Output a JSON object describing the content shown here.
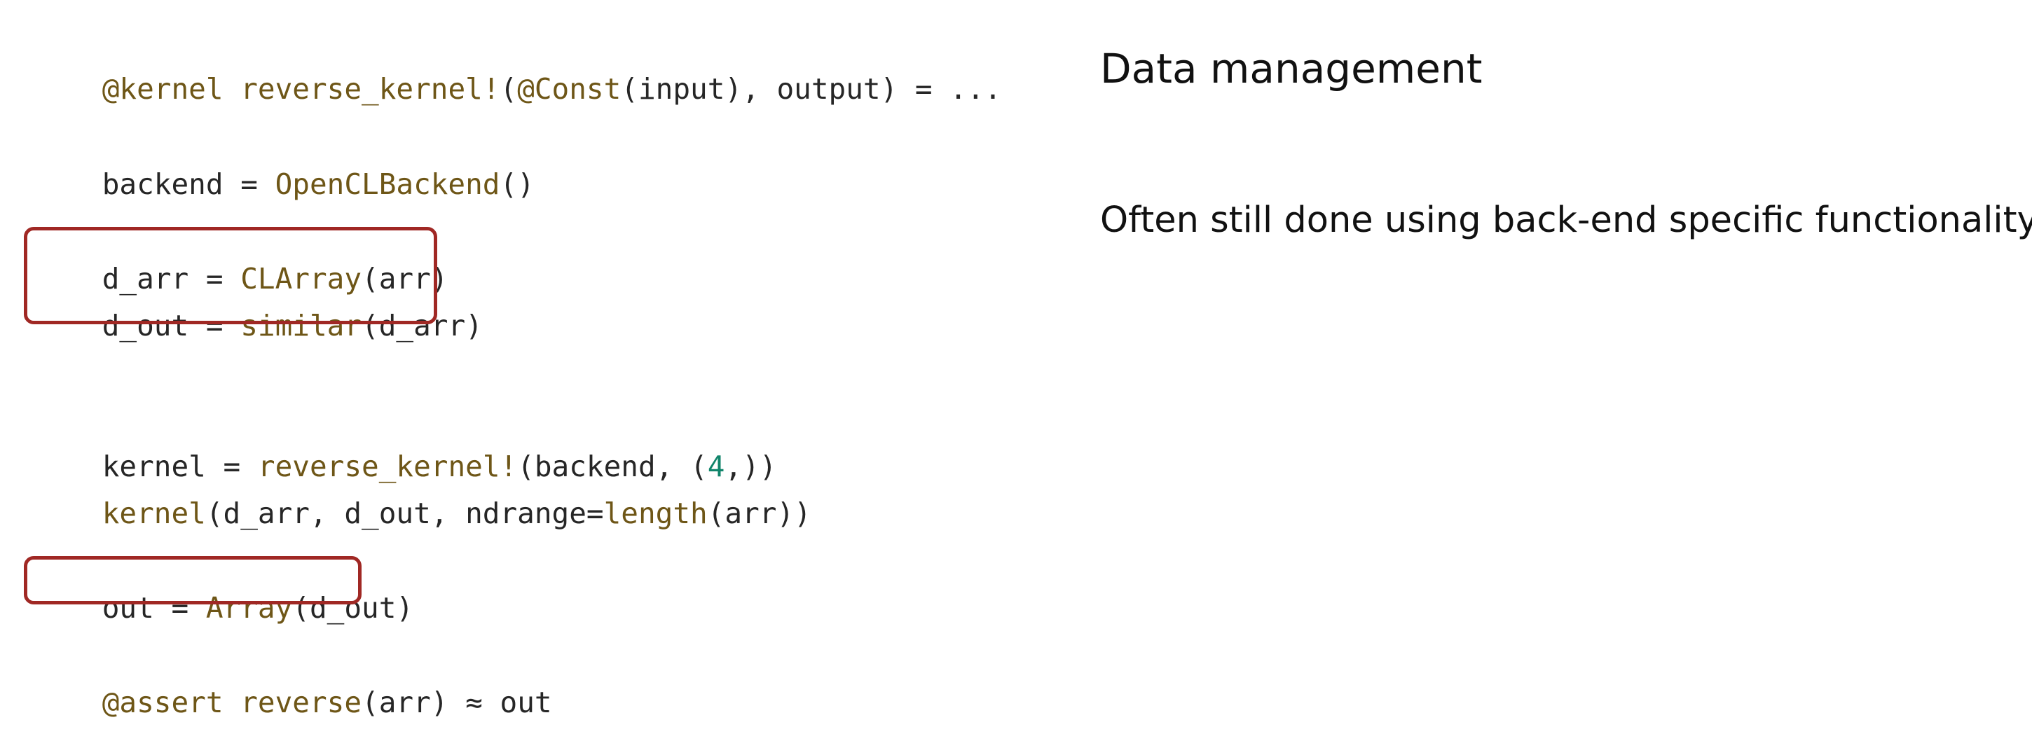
{
  "slide": {
    "heading": "Data management",
    "paragraph": "Often still done using back-end specific functionality."
  },
  "code": {
    "line1": {
      "macro": "@kernel",
      "space": " ",
      "fn": "reverse_kernel!",
      "open": "(",
      "const": "@Const",
      "rest": "(input), output) = ..."
    },
    "line2": {
      "lhs": "backend = ",
      "fn": "OpenCLBackend",
      "rest": "()"
    },
    "line3": {
      "lhs": "d_arr = ",
      "fn": "CLArray",
      "rest": "(arr)"
    },
    "line4": {
      "lhs": "d_out = ",
      "fn": "similar",
      "rest": "(d_arr)"
    },
    "line5": {
      "lhs": "kernel = ",
      "fn": "reverse_kernel!",
      "mid": "(backend, (",
      "num": "4",
      "rest": ",))"
    },
    "line6": {
      "fn": "kernel",
      "mid": "(d_arr, d_out, ndrange=",
      "fn2": "length",
      "rest": "(arr))"
    },
    "line7": {
      "lhs": "out = ",
      "fn": "Array",
      "rest": "(d_out)"
    },
    "line8": {
      "macro": "@assert",
      "space": " ",
      "fn": "reverse",
      "rest": "(arr) ≈ out"
    }
  },
  "colors": {
    "code_text": "#262626",
    "function_name": "#6e5617",
    "number_literal": "#11856b",
    "highlight_border": "#a02824"
  }
}
